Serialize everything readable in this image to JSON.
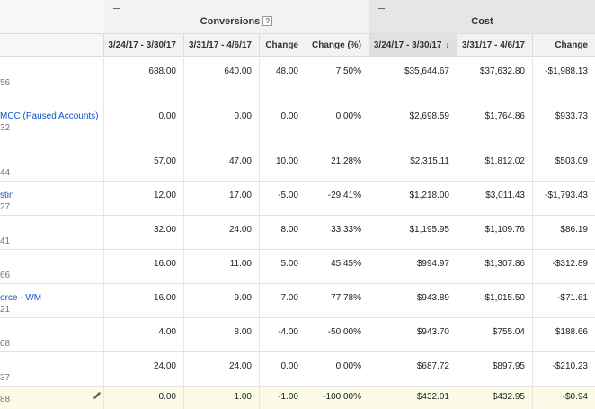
{
  "groups": [
    {
      "key": "conversions",
      "title": "Conversions",
      "collapse_symbol": "–",
      "has_help": true,
      "help_symbol": "?"
    },
    {
      "key": "cost",
      "title": "Cost",
      "collapse_symbol": "–",
      "has_help": false
    }
  ],
  "columns": [
    {
      "key": "conv_a",
      "label": "3/24/17 - 3/30/17"
    },
    {
      "key": "conv_b",
      "label": "3/31/17 - 4/6/17"
    },
    {
      "key": "conv_change",
      "label": "Change"
    },
    {
      "key": "conv_pct",
      "label": "Change (%)"
    },
    {
      "key": "cost_a",
      "label": "3/24/17 - 3/30/17",
      "sort_icon": "arrow-down-icon",
      "sort_symbol": "↓"
    },
    {
      "key": "cost_b",
      "label": "3/31/17 - 4/6/17"
    },
    {
      "key": "cost_change",
      "label": "Change"
    }
  ],
  "rows": [
    {
      "name": "",
      "id": "56",
      "values": [
        "688.00",
        "640.00",
        "48.00",
        "7.50%",
        "$35,644.67",
        "$37,632.80",
        "-$1,988.13"
      ]
    },
    {
      "name": "MCC (Paused Accounts)",
      "id": "32",
      "values": [
        "0.00",
        "0.00",
        "0.00",
        "0.00%",
        "$2,698.59",
        "$1,764.86",
        "$933.73"
      ]
    },
    {
      "name": "",
      "id": "44",
      "values": [
        "57.00",
        "47.00",
        "10.00",
        "21.28%",
        "$2,315.11",
        "$1,812.02",
        "$503.09"
      ]
    },
    {
      "name": "stin",
      "id": "27",
      "values": [
        "12.00",
        "17.00",
        "-5.00",
        "-29.41%",
        "$1,218.00",
        "$3,011.43",
        "-$1,793.43"
      ]
    },
    {
      "name": "",
      "id": "41",
      "values": [
        "32.00",
        "24.00",
        "8.00",
        "33.33%",
        "$1,195.95",
        "$1,109.76",
        "$86.19"
      ]
    },
    {
      "name": "",
      "id": "66",
      "values": [
        "16.00",
        "11.00",
        "5.00",
        "45.45%",
        "$994.97",
        "$1,307.86",
        "-$312.89"
      ]
    },
    {
      "name": "orce - WM",
      "id": "21",
      "values": [
        "16.00",
        "9.00",
        "7.00",
        "77.78%",
        "$943.89",
        "$1,015.50",
        "-$71.61"
      ]
    },
    {
      "name": "",
      "id": "08",
      "values": [
        "4.00",
        "8.00",
        "-4.00",
        "-50.00%",
        "$943.70",
        "$755.04",
        "$188.66"
      ]
    },
    {
      "name": "",
      "id": "37",
      "values": [
        "24.00",
        "24.00",
        "0.00",
        "0.00%",
        "$687.72",
        "$897.95",
        "-$210.23"
      ]
    },
    {
      "name": "",
      "id": "88",
      "values": [
        "0.00",
        "1.00",
        "-1.00",
        "-100.00%",
        "$432.01",
        "$432.95",
        "-$0.94"
      ],
      "highlighted": true,
      "edit_icon": "pencil-icon"
    }
  ]
}
